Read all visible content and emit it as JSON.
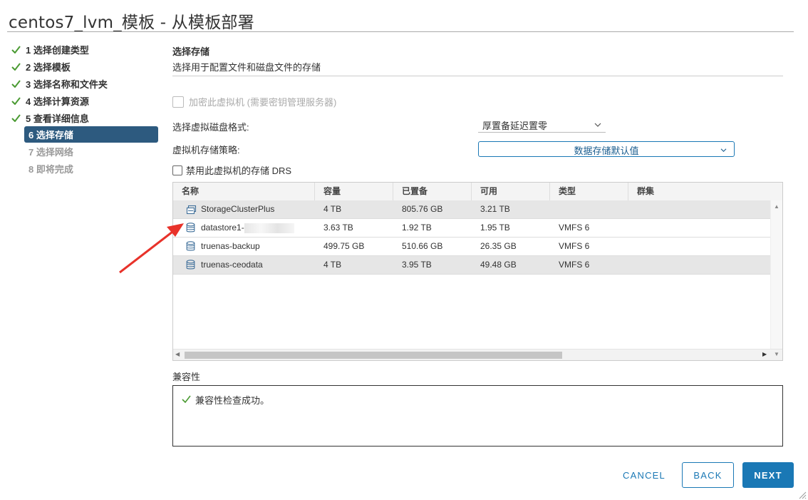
{
  "window": {
    "title": "centos7_lvm_模板 - 从模板部署"
  },
  "steps": [
    {
      "label": "1 选择创建类型",
      "state": "done"
    },
    {
      "label": "2 选择模板",
      "state": "done"
    },
    {
      "label": "3 选择名称和文件夹",
      "state": "done"
    },
    {
      "label": "4 选择计算资源",
      "state": "done"
    },
    {
      "label": "5 查看详细信息",
      "state": "done"
    },
    {
      "label": "6 选择存储",
      "state": "active"
    },
    {
      "label": "7 选择网络",
      "state": "pending"
    },
    {
      "label": "8 即将完成",
      "state": "pending"
    }
  ],
  "section": {
    "title": "选择存储",
    "subtitle": "选择用于配置文件和磁盘文件的存储"
  },
  "form": {
    "encrypt_label": "加密此虚拟机 (需要密钥管理服务器)",
    "disk_format_label": "选择虚拟磁盘格式:",
    "disk_format_value": "厚置备延迟置零",
    "policy_label": "虚拟机存储策略:",
    "policy_value": "数据存储默认值",
    "disable_drs_label": "禁用此虚拟机的存储 DRS"
  },
  "grid": {
    "columns": [
      "名称",
      "容量",
      "已置备",
      "可用",
      "类型",
      "群集"
    ],
    "rows": [
      {
        "name": "StorageClusterPlus",
        "icon": "storage-cluster-icon",
        "capacity": "4 TB",
        "provisioned": "805.76 GB",
        "free": "3.21 TB",
        "type": "",
        "cluster": "",
        "selected": true
      },
      {
        "name": "datastore1-",
        "icon": "datastore-icon",
        "capacity": "3.63 TB",
        "provisioned": "1.92 TB",
        "free": "1.95 TB",
        "type": "VMFS 6",
        "cluster": "",
        "selected": false,
        "redacted": true
      },
      {
        "name": "truenas-backup",
        "icon": "datastore-icon",
        "capacity": "499.75 GB",
        "provisioned": "510.66 GB",
        "free": "26.35 GB",
        "type": "VMFS 6",
        "cluster": "",
        "selected": false
      },
      {
        "name": "truenas-ceodata",
        "icon": "datastore-icon",
        "capacity": "4 TB",
        "provisioned": "3.95 TB",
        "free": "49.48 GB",
        "type": "VMFS 6",
        "cluster": "",
        "selected": true
      }
    ]
  },
  "compatibility": {
    "label": "兼容性",
    "message": "兼容性检查成功。"
  },
  "buttons": {
    "cancel": "CANCEL",
    "back": "BACK",
    "next": "NEXT"
  },
  "colors": {
    "accent": "#1a78b5",
    "active_step": "#2d5a7f",
    "check": "#4a9a32",
    "annotation_arrow": "#e8322a"
  }
}
